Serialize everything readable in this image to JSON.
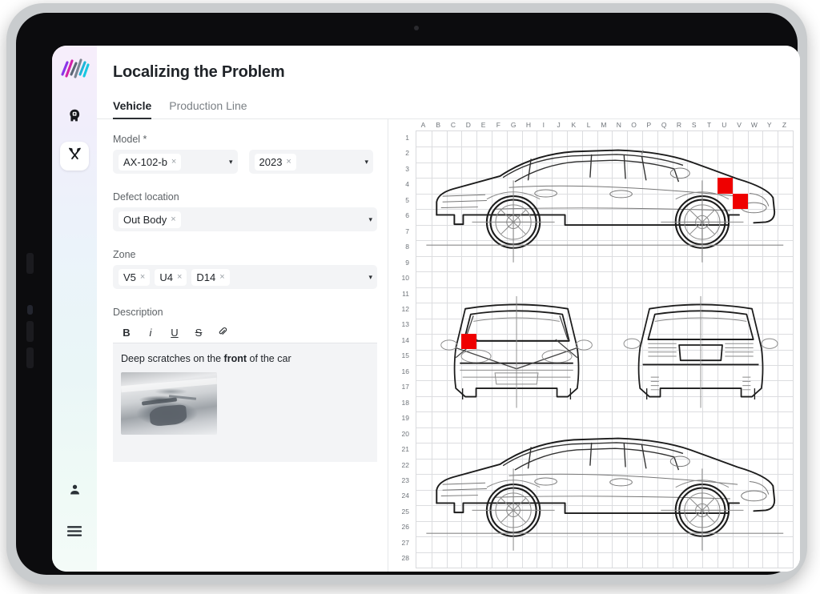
{
  "app": {
    "logo_name": "brand-logo",
    "rail_items": [
      {
        "icon": "ai-head-icon",
        "active": false
      },
      {
        "icon": "tools-icon",
        "active": true
      }
    ],
    "rail_bottom": [
      {
        "icon": "user-icon"
      },
      {
        "icon": "hamburger-menu-icon"
      }
    ]
  },
  "header": {
    "title": "Localizing the Problem"
  },
  "tabs": [
    {
      "label": "Vehicle",
      "active": true
    },
    {
      "label": "Production Line",
      "active": false
    }
  ],
  "form": {
    "model": {
      "label": "Model *",
      "chips": [
        "AX-102-b"
      ],
      "year_chips": [
        "2023"
      ],
      "remove_glyph": "×",
      "caret_glyph": "▾"
    },
    "defect_location": {
      "label": "Defect location",
      "chips": [
        "Out Body"
      ]
    },
    "zone": {
      "label": "Zone",
      "chips": [
        "V5",
        "U4",
        "D14"
      ]
    },
    "description": {
      "label": "Description",
      "toolbar": [
        {
          "name": "bold-button",
          "glyph": "B"
        },
        {
          "name": "italic-button",
          "glyph": "i"
        },
        {
          "name": "underline-button",
          "glyph": "U"
        },
        {
          "name": "strikethrough-button",
          "glyph": "S"
        },
        {
          "name": "attachment-button",
          "glyph": "📎"
        }
      ],
      "text_prefix": "Deep scratches on the ",
      "text_bold": "front",
      "text_suffix": " of the car",
      "attachment_name": "scratch-photo-thumbnail"
    }
  },
  "blueprint": {
    "columns": [
      "A",
      "B",
      "C",
      "D",
      "E",
      "F",
      "G",
      "H",
      "I",
      "J",
      "K",
      "L",
      "M",
      "N",
      "O",
      "P",
      "Q",
      "R",
      "S",
      "T",
      "U",
      "V",
      "W",
      "Y",
      "Z"
    ],
    "rows": [
      1,
      2,
      3,
      4,
      5,
      6,
      7,
      8,
      9,
      10,
      11,
      12,
      13,
      14,
      15,
      16,
      17,
      18,
      19,
      20,
      21,
      22,
      23,
      24,
      25,
      26,
      27,
      28
    ],
    "marker_color": "#ef0000",
    "markers": [
      {
        "col": "U",
        "row": 4,
        "zone": "U4"
      },
      {
        "col": "V",
        "row": 5,
        "zone": "V5"
      },
      {
        "col": "D",
        "row": 14,
        "zone": "D14"
      }
    ],
    "views": [
      {
        "name": "side-view-top",
        "label": "side"
      },
      {
        "name": "front-view",
        "label": "front"
      },
      {
        "name": "rear-view",
        "label": "rear"
      },
      {
        "name": "side-view-bottom",
        "label": "side"
      }
    ]
  }
}
